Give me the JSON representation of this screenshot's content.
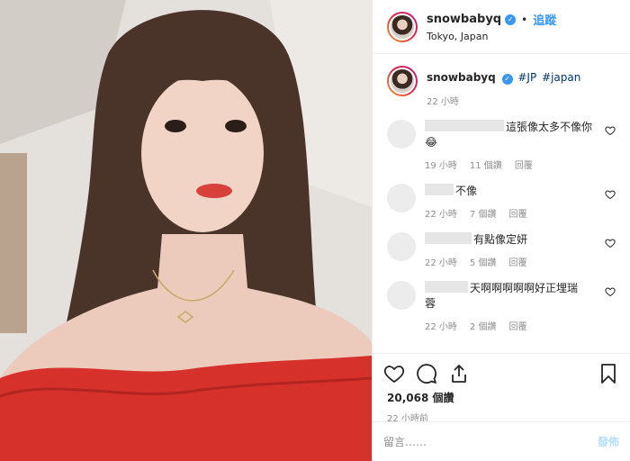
{
  "header": {
    "username": "snowbabyq",
    "follow_label": "追蹤",
    "location": "Tokyo, Japan"
  },
  "caption": {
    "username": "snowbabyq",
    "tags": [
      "#JP",
      "#japan"
    ],
    "time": "22 小時"
  },
  "comments": [
    {
      "text": "這張像太多不像你",
      "emoji": "😂",
      "time": "19 小時",
      "likes": "11 個讚",
      "reply": "回覆"
    },
    {
      "text": "不像",
      "emoji": "",
      "time": "22 小時",
      "likes": "7 個讚",
      "reply": "回覆"
    },
    {
      "text": "有點像定妍",
      "emoji": "",
      "time": "22 小時",
      "likes": "5 個讚",
      "reply": "回覆"
    },
    {
      "text": "天啊啊啊啊啊好正埋瑞",
      "text2": "蓉",
      "emoji": "",
      "time": "22 小時",
      "likes": "2 個讚",
      "reply": "回覆"
    }
  ],
  "stats": {
    "likes": "20,068 個讚",
    "time_ago": "22 小時前"
  },
  "comment_box": {
    "placeholder": "留言……",
    "post_label": "發佈"
  },
  "colors": {
    "accent": "#3897f0",
    "muted": "#8e8e8e",
    "post_disabled": "#b2dffc"
  }
}
